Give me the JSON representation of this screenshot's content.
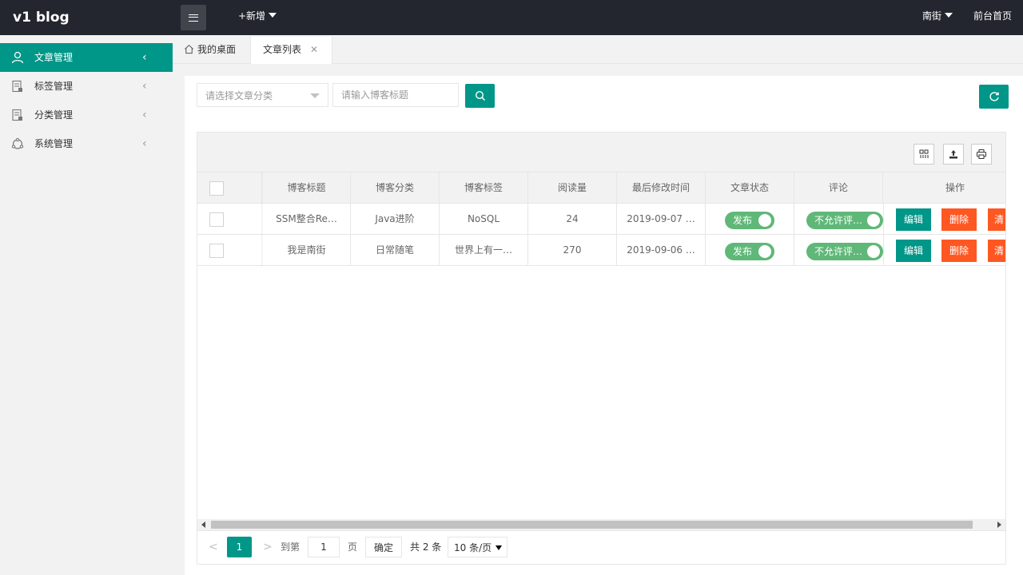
{
  "header": {
    "logo": "v1 blog",
    "add_new": "+新增",
    "user": "南街",
    "front_page": "前台首页"
  },
  "sidebar": {
    "items": [
      {
        "label": "文章管理",
        "icon": "user-icon",
        "active": true
      },
      {
        "label": "标签管理",
        "icon": "tag-doc-icon",
        "active": false
      },
      {
        "label": "分类管理",
        "icon": "category-doc-icon",
        "active": false
      },
      {
        "label": "系统管理",
        "icon": "system-icon",
        "active": false
      }
    ]
  },
  "tabs": {
    "home": "我的桌面",
    "current": "文章列表",
    "close": "✕"
  },
  "filters": {
    "category_placeholder": "请选择文章分类",
    "title_placeholder": "请输入博客标题"
  },
  "table": {
    "headers": [
      "博客标题",
      "博客分类",
      "博客标签",
      "阅读量",
      "最后修改时间",
      "文章状态",
      "评论",
      "操作"
    ],
    "rows": [
      {
        "title": "SSM整合Re…",
        "category": "Java进阶",
        "tag": "NoSQL",
        "views": "24",
        "modified": "2019-09-07 …",
        "status": "发布",
        "comment": "不允许评…",
        "edit": "编辑",
        "delete": "删除",
        "clear": "清"
      },
      {
        "title": "我是南街",
        "category": "日常随笔",
        "tag": "世界上有一…",
        "views": "270",
        "modified": "2019-09-06 …",
        "status": "发布",
        "comment": "不允许评…",
        "edit": "编辑",
        "delete": "删除",
        "clear": "清"
      }
    ]
  },
  "pager": {
    "prev": "<",
    "current": "1",
    "next": ">",
    "goto_label": "到第",
    "goto_value": "1",
    "page_unit": "页",
    "confirm": "确定",
    "total": "共 2 条",
    "page_size": "10 条/页"
  },
  "colors": {
    "accent": "#009688",
    "danger": "#ff5722",
    "switch_on": "#5fb878",
    "header_bg": "#23262e"
  }
}
